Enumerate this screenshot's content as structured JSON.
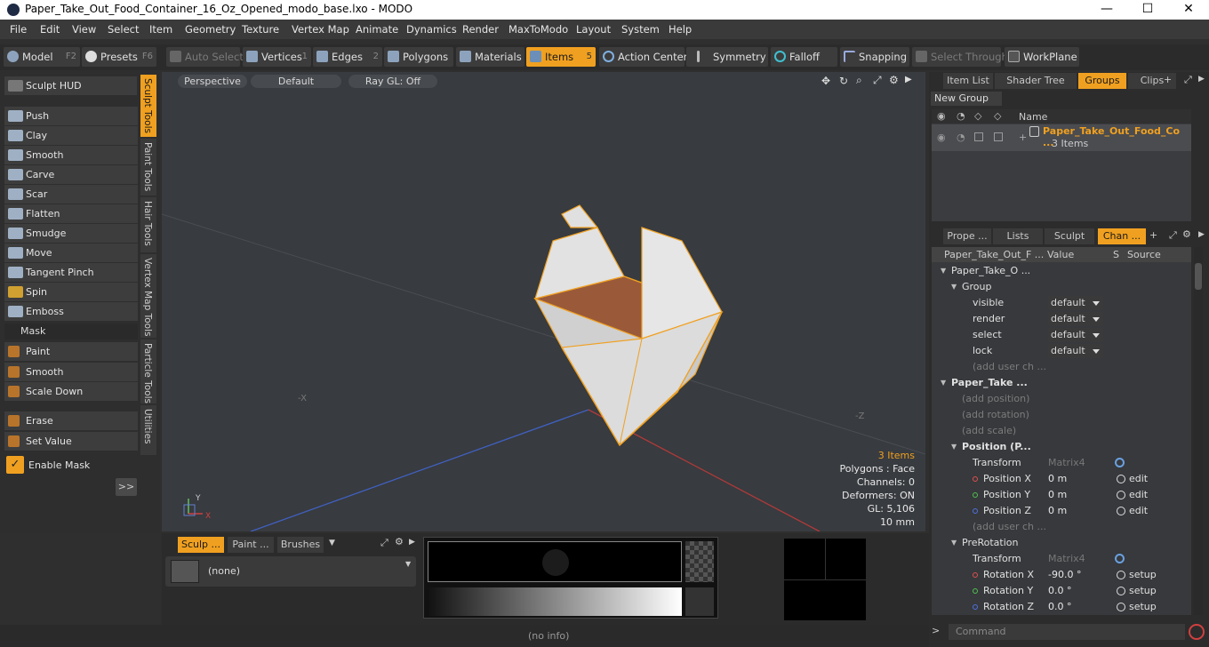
{
  "window": {
    "title": "Paper_Take_Out_Food_Container_16_Oz_Opened_modo_base.lxo - MODO"
  },
  "menu": [
    "File",
    "Edit",
    "View",
    "Select",
    "Item",
    "Geometry",
    "Texture",
    "Vertex Map",
    "Animate",
    "Dynamics",
    "Render",
    "MaxToModo",
    "Layout",
    "System",
    "Help"
  ],
  "toolbar": {
    "model": "Model",
    "model_key": "F2",
    "presets": "Presets",
    "presets_key": "F6",
    "auto_select": "Auto Select",
    "vertices": "Vertices",
    "vertices_key": "1",
    "edges": "Edges",
    "edges_key": "2",
    "polygons": "Polygons",
    "materials": "Materials",
    "items": "Items",
    "items_key": "5",
    "action_center": "Action Center",
    "symmetry": "Symmetry",
    "falloff": "Falloff",
    "snapping": "Snapping",
    "select_through": "Select Through",
    "workplane": "WorkPlane"
  },
  "left": {
    "sculpt_hud": "Sculpt HUD",
    "tools": [
      "Push",
      "Clay",
      "Smooth",
      "Carve",
      "Scar",
      "Flatten",
      "Smudge",
      "Move",
      "Tangent Pinch",
      "Spin",
      "Emboss"
    ],
    "mask_header": "Mask",
    "mask_tools": [
      "Paint",
      "Smooth",
      "Scale Down"
    ],
    "extra_tools": [
      "Erase",
      "Set Value"
    ],
    "enable_mask": "Enable Mask",
    "expand": ">>"
  },
  "vtabs": [
    "Sculpt Tools",
    "Paint Tools",
    "Hair Tools",
    "Vertex Map Tools",
    "Particle Tools",
    "Utilities"
  ],
  "viewport": {
    "perspective": "Perspective",
    "default": "Default",
    "raygl": "Ray GL: Off",
    "info": {
      "items": "3 Items",
      "polygons": "Polygons : Face",
      "channels": "Channels: 0",
      "deformers": "Deformers: ON",
      "gl": "GL: 5,106",
      "scale": "10 mm"
    },
    "axis_x": "X",
    "axis_y": "Y",
    "neg_x": "-X",
    "neg_z": "-Z"
  },
  "bottom": {
    "tabs": [
      "Sculp ...",
      "Paint ...",
      "Brushes"
    ],
    "none": "(none)"
  },
  "status": {
    "info": "(no info)",
    "command": "Command"
  },
  "right": {
    "top_tabs": [
      "Item List",
      "Shader Tree",
      "Groups",
      "Clips"
    ],
    "new_group": "New Group",
    "col_name": "Name",
    "group_name": "Paper_Take_Out_Food_Co ...",
    "group_count": "3 Items",
    "mid_tabs": [
      "Prope ...",
      "Lists",
      "Sculpt",
      "Chan ..."
    ],
    "ch_headers": [
      "Paper_Take_Out_F ...",
      "Value",
      "S",
      "Source"
    ],
    "rows": [
      {
        "label": "Paper_Take_O ...",
        "indent": 1,
        "kind": "item"
      },
      {
        "label": "Group",
        "indent": 2,
        "kind": "item"
      },
      {
        "label": "visible",
        "indent": 3,
        "value": "default",
        "kind": "dd"
      },
      {
        "label": "render",
        "indent": 3,
        "value": "default",
        "kind": "dd"
      },
      {
        "label": "select",
        "indent": 3,
        "value": "default",
        "kind": "dd"
      },
      {
        "label": "lock",
        "indent": 3,
        "value": "default",
        "kind": "dd"
      },
      {
        "label": "(add user ch ...",
        "indent": 3,
        "kind": "dim"
      },
      {
        "label": "Paper_Take ...",
        "indent": 1,
        "kind": "bold"
      },
      {
        "label": "(add position)",
        "indent": 2,
        "kind": "dim"
      },
      {
        "label": "(add rotation)",
        "indent": 2,
        "kind": "dim"
      },
      {
        "label": "(add scale)",
        "indent": 2,
        "kind": "dim"
      },
      {
        "label": "Position (P...",
        "indent": 2,
        "kind": "bold"
      },
      {
        "label": "Transform",
        "indent": 3,
        "value": "Matrix4",
        "kind": "matrix"
      },
      {
        "label": "Position X",
        "indent": 3,
        "value": "0 m",
        "source": "edit",
        "kind": "val",
        "dot": "#e05050"
      },
      {
        "label": "Position Y",
        "indent": 3,
        "value": "0 m",
        "source": "edit",
        "kind": "val",
        "dot": "#50c050"
      },
      {
        "label": "Position Z",
        "indent": 3,
        "value": "0 m",
        "source": "edit",
        "kind": "val",
        "dot": "#5070e0"
      },
      {
        "label": "(add user ch ...",
        "indent": 3,
        "kind": "dim"
      },
      {
        "label": "PreRotation",
        "indent": 2,
        "kind": "item"
      },
      {
        "label": "Transform",
        "indent": 3,
        "value": "Matrix4",
        "kind": "matrix"
      },
      {
        "label": "Rotation X",
        "indent": 3,
        "value": "-90.0 °",
        "source": "setup",
        "kind": "val",
        "dot": "#e05050"
      },
      {
        "label": "Rotation Y",
        "indent": 3,
        "value": "0.0 °",
        "source": "setup",
        "kind": "val",
        "dot": "#50c050"
      },
      {
        "label": "Rotation Z",
        "indent": 3,
        "value": "0.0 °",
        "source": "setup",
        "kind": "val",
        "dot": "#5070e0"
      }
    ]
  },
  "colors": {
    "accent": "#f0a020",
    "panel": "#2c2c2c",
    "viewport": "#383b3f"
  }
}
